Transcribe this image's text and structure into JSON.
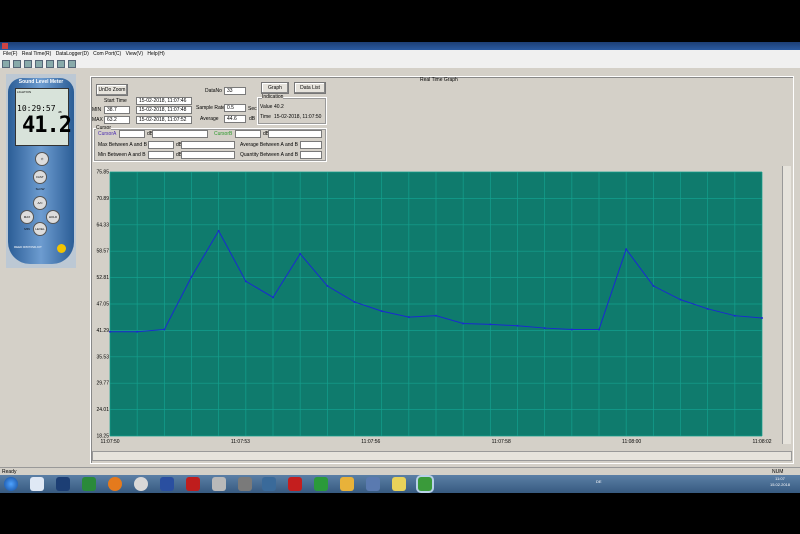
{
  "menu": [
    "File(F)",
    "Real Time(R)",
    "DataLogger(D)",
    "Com Port(C)",
    "View(V)",
    "Help(H)"
  ],
  "device": {
    "title": "Sound Level Meter",
    "time": "10:29:57",
    "value": "41.2",
    "buttons": [
      "FAST SLOW",
      "A/C",
      "MAX MIN",
      "HOLD",
      "LEVEL"
    ],
    "brand": "REED R8070SD-KIT",
    "top_label": "LIGHT/ON",
    "small_label": "dB"
  },
  "panel_title": "Real Time Graph",
  "controls": {
    "zoom_btn": "UnDo Zoom",
    "datano_label": "DataNo",
    "datano_value": "33",
    "graph_btn": "Graph",
    "datalist_btn": "Data List",
    "start_time_label": "Start Time",
    "start_time_value": "15-02-2018, 11:07:46",
    "min_label": "MIN",
    "min_value": "38.7",
    "min_time": "15-02-2018, 11:07:48",
    "max_label": "MAX",
    "max_value": "63.2",
    "max_time": "15-02-2018, 11:07:52",
    "sample_rate_label": "Sample Rate",
    "sample_rate_value": "0.5",
    "sample_rate_unit": "Sec",
    "average_label": "Average",
    "average_value": "44.6",
    "average_unit": "dB",
    "indication_label": "Indication",
    "value_label": "Value",
    "value_value": "40.2",
    "time_label": "Time",
    "time_value": "15-02-2018, 11:07:50",
    "cursor_label": "Cursor",
    "cursor_a_label": "CursorA",
    "cursor_b_label": "CursorB",
    "max_between_label": "Max Between A and B",
    "min_between_label": "Min Between A and B",
    "avg_between_label": "Average Between A and B",
    "qty_between_label": "Quantity Between A and B"
  },
  "chart_data": {
    "type": "line",
    "x": [
      "11:07:50",
      "11:07:50.5",
      "11:07:51",
      "11:07:51.5",
      "11:07:52",
      "11:07:52.5",
      "11:07:53",
      "11:07:53.5",
      "11:07:54",
      "11:07:54.5",
      "11:07:55",
      "11:07:55.5",
      "11:07:56",
      "11:07:56.5",
      "11:07:57",
      "11:07:57.5",
      "11:07:58",
      "11:07:58.5",
      "11:07:59",
      "11:07:59.5",
      "11:08:00",
      "11:08:00.5",
      "11:08:01",
      "11:08:01.5",
      "11:08:02"
    ],
    "values": [
      41.0,
      41.0,
      41.5,
      53.0,
      63.0,
      52.0,
      48.5,
      58.0,
      51.0,
      47.5,
      45.5,
      44.2,
      44.5,
      42.8,
      42.6,
      42.3,
      41.8,
      41.5,
      41.5,
      59.0,
      51.0,
      48.0,
      46.0,
      44.5,
      44.0
    ],
    "ylim": [
      18.25,
      75.85
    ],
    "yticks": [
      "75.85",
      "70.89",
      "64.33",
      "58.57",
      "52.81",
      "47.05",
      "41.29",
      "35.53",
      "29.77",
      "24.01",
      "18.25"
    ],
    "xticks": [
      "11:07:50",
      "11:07:53",
      "11:07:56",
      "11:07:58",
      "11:08:00",
      "11:08:02"
    ],
    "grid": true,
    "colors": {
      "background": "#0f7b6d",
      "grid": "#14a08e",
      "line": "#1a2ad0"
    }
  },
  "status": {
    "left": "Ready",
    "right": "NUM"
  },
  "tray": {
    "lang": "DE",
    "time": "11:07",
    "date": "15.02.2018"
  }
}
